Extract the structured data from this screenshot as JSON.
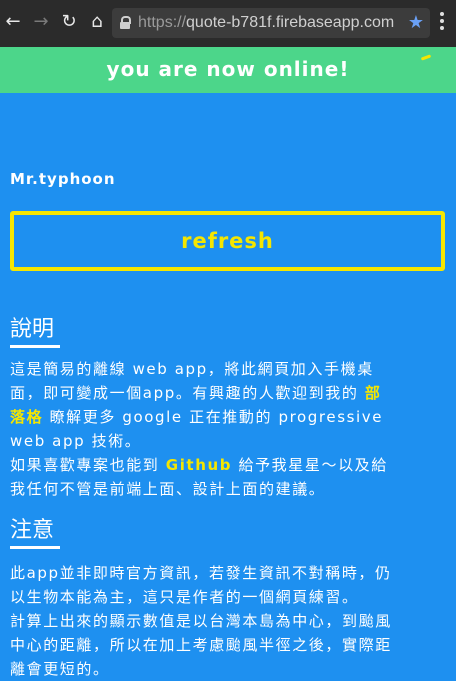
{
  "browser": {
    "url_scheme": "https://",
    "url_host": "quote-b781f.firebaseapp.com",
    "back_icon": "arrow-left-icon",
    "forward_icon": "arrow-right-icon",
    "reload_icon": "reload-icon",
    "bookmark_icon": "star-icon",
    "menu_icon": "vertical-dots-icon"
  },
  "toast": {
    "text": "you are now online!"
  },
  "header": {
    "author": "Mr.typhoon"
  },
  "refresh_label": "refresh",
  "about": {
    "title": "說明",
    "line1": "這是簡易的離線 web app，將此網頁加入手機桌",
    "line2a": "面，即可變成一個app。有興趣的人歡迎到我的 ",
    "link_blog_1": "部",
    "link_blog_2": "落格",
    "line3b": " 瞭解更多 google 正在推動的 progressive",
    "line4": "web app 技術。",
    "line5a": "如果喜歡專案也能到 ",
    "link_github": "Github",
    "line5b": " 給予我星星～以及給",
    "line6": "我任何不管是前端上面、設計上面的建議。"
  },
  "notice": {
    "title": "注意",
    "line1": "此app並非即時官方資訊，若發生資訊不對稱時，仍",
    "line2": "以生物本能為主，這只是作者的一個網頁練習。",
    "line3": "計算上出來的顯示數值是以台灣本島為中心，到颱風",
    "line4": "中心的距離，所以在加上考慮颱風半徑之後，實際距",
    "line5": "離會更短的。"
  },
  "colors": {
    "background": "#1e90f0",
    "toast": "#4cd68a",
    "accent": "#f5e600",
    "text": "#ffffff"
  }
}
